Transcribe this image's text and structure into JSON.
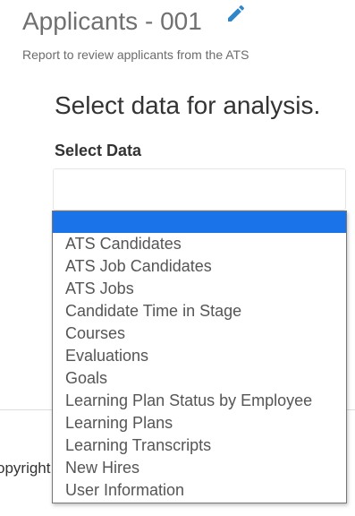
{
  "report": {
    "title": "Applicants - 001",
    "subtitle": "Report to review applicants from the ATS"
  },
  "section": {
    "heading": "Select data for analysis."
  },
  "select_data": {
    "label": "Select Data",
    "selected_value": "",
    "options": [
      "",
      "ATS Candidates",
      "ATS Job Candidates",
      "ATS Jobs",
      "Candidate Time in Stage",
      "Courses",
      "Evaluations",
      "Goals",
      "Learning Plan Status by Employee",
      "Learning Plans",
      "Learning Transcripts",
      "New Hires",
      "User Information"
    ]
  },
  "footer": {
    "copyright_fragment": "opyright"
  },
  "icons": {
    "edit": "pencil-icon"
  },
  "colors": {
    "accent": "#2f86c9",
    "highlight": "#1a73e8"
  }
}
